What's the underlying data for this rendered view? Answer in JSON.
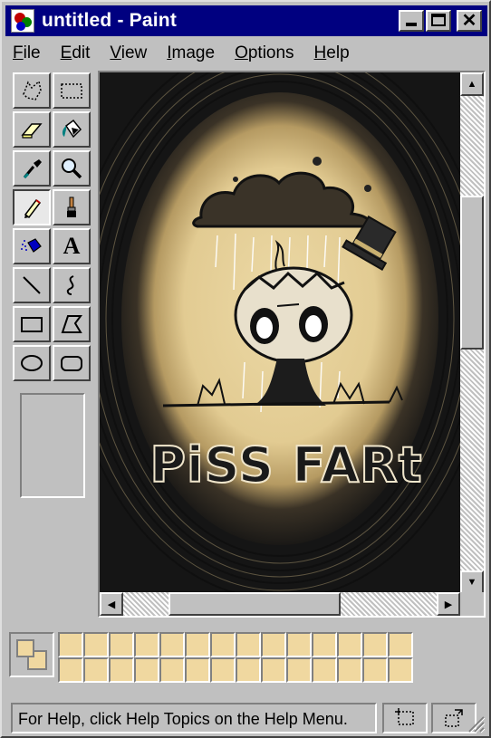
{
  "window": {
    "title": "untitled - Paint",
    "icon": "paint-app-icon",
    "controls": [
      "minimize-icon",
      "maximize-icon",
      "close-icon"
    ],
    "close_glyph": "✕"
  },
  "menu": [
    {
      "label": "File",
      "underline": "F",
      "rest": "ile"
    },
    {
      "label": "Edit",
      "underline": "E",
      "rest": "dit"
    },
    {
      "label": "View",
      "underline": "V",
      "rest": "iew"
    },
    {
      "label": "Image",
      "underline": "I",
      "rest": "mage"
    },
    {
      "label": "Options",
      "underline": "O",
      "rest": "ptions"
    },
    {
      "label": "Help",
      "underline": "H",
      "rest": "elp"
    }
  ],
  "tools": [
    {
      "name": "free-form-select",
      "icon": "free-select-icon",
      "active": false
    },
    {
      "name": "select",
      "icon": "rect-select-icon",
      "active": false
    },
    {
      "name": "eraser",
      "icon": "eraser-icon",
      "active": false
    },
    {
      "name": "fill-with-color",
      "icon": "fill-bucket-icon",
      "active": false
    },
    {
      "name": "pick-color",
      "icon": "eyedropper-icon",
      "active": false
    },
    {
      "name": "magnifier",
      "icon": "magnifier-icon",
      "active": false
    },
    {
      "name": "pencil",
      "icon": "pencil-icon",
      "active": true
    },
    {
      "name": "brush",
      "icon": "brush-icon",
      "active": false
    },
    {
      "name": "airbrush",
      "icon": "airbrush-icon",
      "active": false
    },
    {
      "name": "text",
      "icon": "text-icon",
      "active": false
    },
    {
      "name": "line",
      "icon": "line-icon",
      "active": false
    },
    {
      "name": "curve",
      "icon": "curve-icon",
      "active": false
    },
    {
      "name": "rectangle",
      "icon": "rectangle-icon",
      "active": false
    },
    {
      "name": "polygon",
      "icon": "polygon-icon",
      "active": false
    },
    {
      "name": "ellipse",
      "icon": "ellipse-icon",
      "active": false
    },
    {
      "name": "rounded-rectangle",
      "icon": "rounded-rect-icon",
      "active": false
    }
  ],
  "text_tool_glyph": "A",
  "canvas": {
    "artwork_caption": "PiSS FARt",
    "colors": {
      "background_dark": "#151515",
      "glow": "#e8d3a0",
      "ink": "#1a1a1a"
    }
  },
  "scrollbars": {
    "up_glyph": "▲",
    "down_glyph": "▼",
    "left_glyph": "◀",
    "right_glyph": "▶"
  },
  "palette": {
    "foreground": "#f0d8a0",
    "background": "#f0d8a0",
    "swatch_color": "#f0d8a0",
    "swatch_count": 28
  },
  "status": {
    "text": "For Help, click Help Topics on the Help Menu."
  }
}
